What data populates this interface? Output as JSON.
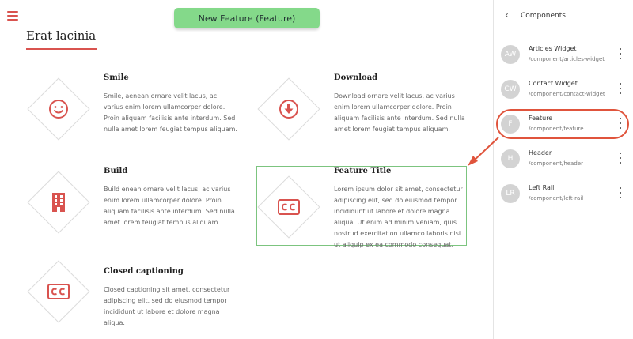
{
  "toolbar": {
    "new_feature_label": "New Feature (Feature)"
  },
  "page": {
    "title": "Erat lacinia"
  },
  "features": [
    {
      "title": "Smile",
      "body": "Smile, aenean ornare velit lacus, ac varius enim lorem ullamcorper dolore. Proin aliquam facilisis ante interdum. Sed nulla amet lorem feugiat tempus aliquam.",
      "icon": "smile-icon"
    },
    {
      "title": "Download",
      "body": "Download ornare velit lacus, ac varius enim lorem ullamcorper dolore. Proin aliquam facilisis ante interdum. Sed nulla amet lorem feugiat tempus aliquam.",
      "icon": "download-icon"
    },
    {
      "title": "Build",
      "body": "Build enean ornare velit lacus, ac varius enim lorem ullamcorper dolore. Proin aliquam facilisis ante interdum. Sed nulla amet lorem feugiat tempus aliquam.",
      "icon": "building-icon"
    },
    {
      "title": "Feature Title",
      "body": "Lorem ipsum dolor sit amet, consectetur adipiscing elit, sed do eiusmod tempor incididunt ut labore et dolore magna aliqua. Ut enim ad minim veniam, quis nostrud exercitation ullamco laboris nisi ut aliquip ex ea commodo consequat.",
      "icon": "closed-captioning-icon"
    },
    {
      "title": "Closed captioning",
      "body": "Closed captioning sit amet, consectetur adipiscing elit, sed do eiusmod tempor incididunt ut labore et dolore magna aliqua.",
      "icon": "closed-captioning-icon"
    }
  ],
  "panel": {
    "title": "Components",
    "items": [
      {
        "initials": "AW",
        "name": "Articles Widget",
        "path": "/component/articles-widget"
      },
      {
        "initials": "CW",
        "name": "Contact Widget",
        "path": "/component/contact-widget"
      },
      {
        "initials": "F",
        "name": "Feature",
        "path": "/component/feature"
      },
      {
        "initials": "H",
        "name": "Header",
        "path": "/component/header"
      },
      {
        "initials": "LR",
        "name": "Left Rail",
        "path": "/component/left-rail"
      }
    ]
  },
  "colors": {
    "accent": "#d9534f",
    "button_green": "#84d98a",
    "highlight_red": "#e0543c",
    "selection_green": "#7cc47f"
  }
}
